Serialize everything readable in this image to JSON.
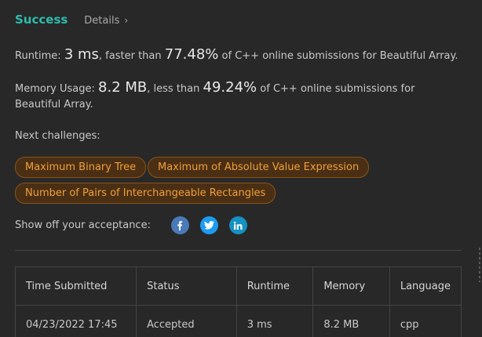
{
  "header": {
    "status": "Success",
    "details_label": "Details",
    "chevron": "›"
  },
  "runtime": {
    "label": "Runtime:",
    "value": "3 ms",
    "mid": ", faster than",
    "percent": "77.48%",
    "tail": "of C++ online submissions for Beautiful Array."
  },
  "memory": {
    "label": "Memory Usage:",
    "value": "8.2 MB",
    "mid": ", less than",
    "percent": "49.24%",
    "tail": "of C++ online submissions for Beautiful Array."
  },
  "next": {
    "label": "Next challenges:",
    "items": [
      "Maximum Binary Tree",
      "Maximum of Absolute Value Expression",
      "Number of Pairs of Interchangeable Rectangles"
    ]
  },
  "share": {
    "label": "Show off your acceptance:",
    "icons": [
      "facebook-icon",
      "twitter-icon",
      "linkedin-icon"
    ]
  },
  "table": {
    "headers": [
      "Time Submitted",
      "Status",
      "Runtime",
      "Memory",
      "Language"
    ],
    "rows": [
      {
        "time": "04/23/2022 17:45",
        "status": "Accepted",
        "runtime": "3 ms",
        "memory": "8.2 MB",
        "language": "cpp"
      }
    ]
  },
  "colors": {
    "background": "#282828",
    "success": "#2cbbad",
    "tag_text": "#f0a03a",
    "tag_bg": "#4a2f14"
  }
}
